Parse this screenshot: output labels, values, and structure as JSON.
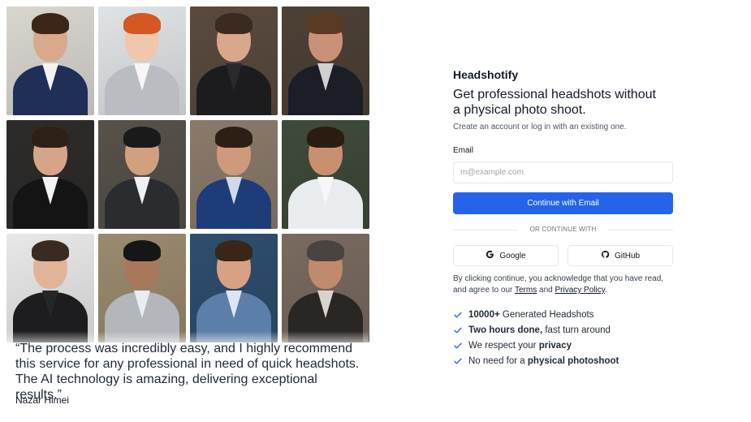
{
  "app": {
    "brand": "Headshotify",
    "headline": "Get professional headshots without a physical photo shoot.",
    "subtitle": "Create an account or log in with an existing one."
  },
  "form": {
    "email_label": "Email",
    "email_placeholder": "m@example.com",
    "email_value": "",
    "continue_button": "Continue with Email",
    "divider": "OR CONTINUE WITH",
    "google_button": "Google",
    "github_button": "GitHub"
  },
  "legal": {
    "prefix": "By clicking continue, you acknowledge that you have read, and agree to our ",
    "terms": "Terms",
    "and": " and ",
    "privacy": "Privacy Policy",
    "suffix": "."
  },
  "features": [
    {
      "bold": "10000+",
      "rest": " Generated Headshots"
    },
    {
      "bold": "Two hours done,",
      "rest": " fast turn around"
    },
    {
      "pre": "We respect your ",
      "bold": "privacy"
    },
    {
      "pre": "No need for a ",
      "bold": "physical photoshoot"
    }
  ],
  "testimonial": {
    "quote": "“The process was incredibly easy, and I highly recommend this service for any professional in need of quick headshots. The AI technology is amazing, delivering exceptional results.”",
    "author": "Nazar Himei"
  },
  "colors": {
    "primary": "#2563eb",
    "check": "#2563eb",
    "border": "#e5e7eb"
  },
  "photos": [
    {
      "icon": "man-navy-suit-red-tie-photo",
      "bg": "#d9d6d0",
      "skin": "#d8a98a",
      "hair": "#3b2618",
      "suit": "#1f2f57",
      "collar": "#f3f3f3"
    },
    {
      "icon": "woman-red-hair-grey-blazer-photo",
      "bg": "#dfe3e6",
      "skin": "#f0c6ad",
      "hair": "#d4581f",
      "suit": "#b9bdc2",
      "collar": "#f6f6f6"
    },
    {
      "icon": "woman-long-hair-black-blazer-photo",
      "bg": "#5a4a3e",
      "skin": "#d9a88a",
      "hair": "#3b2a1f",
      "suit": "#1c1c1e",
      "collar": "#2a2a2c"
    },
    {
      "icon": "man-dark-suit-building-photo",
      "bg": "#4d4136",
      "skin": "#c99276",
      "hair": "#5a3a22",
      "suit": "#1b1e27",
      "collar": "#d0d0d0"
    },
    {
      "icon": "man-glasses-black-suit-photo",
      "bg": "#2e2c2a",
      "skin": "#d6a487",
      "hair": "#2d2016",
      "suit": "#141414",
      "collar": "#f2f2f2"
    },
    {
      "icon": "man-asian-grey-suit-photo",
      "bg": "#56524a",
      "skin": "#d1a07e",
      "hair": "#1a1a1a",
      "suit": "#2a2c30",
      "collar": "#eef0f2"
    },
    {
      "icon": "man-blue-suit-office-photo",
      "bg": "#8a7a6a",
      "skin": "#cf9a7b",
      "hair": "#2e1f15",
      "suit": "#1e3c7a",
      "collar": "#cfd9ea"
    },
    {
      "icon": "man-white-suit-street-photo",
      "bg": "#3e4a3a",
      "skin": "#c9906e",
      "hair": "#2b1c12",
      "suit": "#e9ecef",
      "collar": "#f7f7f7"
    },
    {
      "icon": "woman-black-blazer-white-bg-photo",
      "bg": "#e8e8e8",
      "skin": "#e1b49a",
      "hair": "#3a2a22",
      "suit": "#1d1d1f",
      "collar": "#262628"
    },
    {
      "icon": "man-goatee-grey-suit-photo",
      "bg": "#9a8a6e",
      "skin": "#a9785a",
      "hair": "#161616",
      "suit": "#b3b6ba",
      "collar": "#e8edf2"
    },
    {
      "icon": "man-smiling-light-blue-shirt-photo",
      "bg": "#2e4e6e",
      "skin": "#d7a283",
      "hair": "#3a2517",
      "suit": "#5b7fa8",
      "collar": "#dbe6f3"
    },
    {
      "icon": "man-grey-beard-scarf-photo",
      "bg": "#7a6a60",
      "skin": "#c08b6c",
      "hair": "#4a4440",
      "suit": "#2a2624",
      "collar": "#d8d4cc"
    }
  ]
}
